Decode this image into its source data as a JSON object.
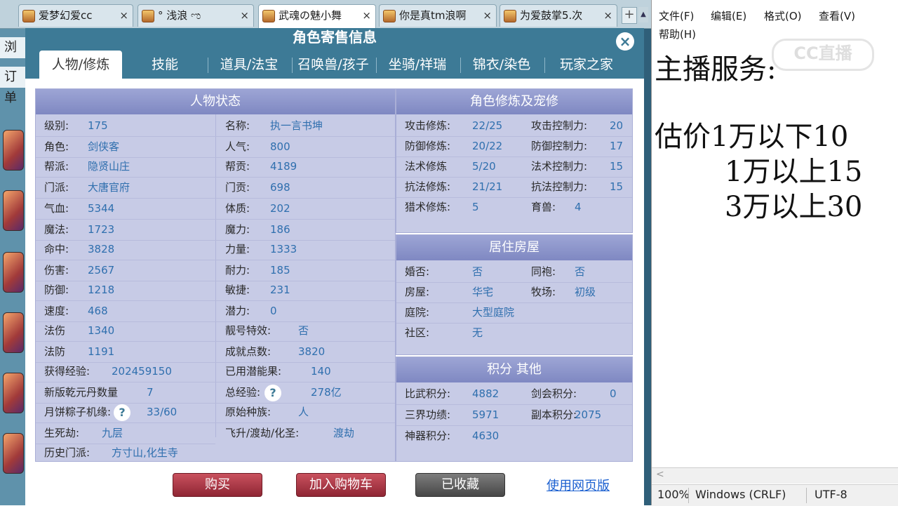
{
  "browser": {
    "tabs": [
      {
        "label": "爱梦幻爱cc",
        "close": "×",
        "active": false
      },
      {
        "label": "°  浅浪 ಌ",
        "close": "×",
        "active": false
      },
      {
        "label": "武魂の魅小舞",
        "close": "×",
        "active": true
      },
      {
        "label": "你是真tm浪啊",
        "close": "×",
        "active": false
      },
      {
        "label": "为爱鼓掌5.次",
        "close": "×",
        "active": false
      }
    ],
    "new_tab": "+",
    "left_labels": [
      "浏",
      "订单"
    ]
  },
  "dialog": {
    "title": "角色寄售信息",
    "close": "×",
    "tabs": [
      "人物/修炼",
      "技能",
      "道具/法宝",
      "召唤兽/孩子",
      "坐骑/祥瑞",
      "锦衣/染色",
      "玩家之家"
    ],
    "status": {
      "header": "人物状态",
      "left": [
        {
          "k": "级别:",
          "v": "175"
        },
        {
          "k": "角色:",
          "v": "剑侠客"
        },
        {
          "k": "帮派:",
          "v": "隐贤山庄"
        },
        {
          "k": "门派:",
          "v": "大唐官府"
        },
        {
          "k": "气血:",
          "v": "5344"
        },
        {
          "k": "魔法:",
          "v": "1723"
        },
        {
          "k": "命中:",
          "v": "3828"
        },
        {
          "k": "伤害:",
          "v": "2567"
        },
        {
          "k": "防御:",
          "v": "1218"
        },
        {
          "k": "速度:",
          "v": "468"
        },
        {
          "k": "法伤",
          "v": "1340"
        },
        {
          "k": "法防",
          "v": "1191"
        },
        {
          "k": "获得经验:",
          "v": "202459150"
        },
        {
          "k": "新版乾元丹数量",
          "v": "7"
        },
        {
          "k": "月饼粽子机缘:",
          "v": "33/60"
        },
        {
          "k": "生死劫:",
          "v": "九层"
        },
        {
          "k": "历史门派:",
          "v": "方寸山,化生寺"
        }
      ],
      "right": [
        {
          "k": "名称:",
          "v": "执一言书坤"
        },
        {
          "k": "人气:",
          "v": "800"
        },
        {
          "k": "帮贡:",
          "v": "4189"
        },
        {
          "k": "门贡:",
          "v": "698"
        },
        {
          "k": "体质:",
          "v": "202"
        },
        {
          "k": "魔力:",
          "v": "186"
        },
        {
          "k": "力量:",
          "v": "1333"
        },
        {
          "k": "耐力:",
          "v": "185"
        },
        {
          "k": "敏捷:",
          "v": "231"
        },
        {
          "k": "潜力:",
          "v": "0"
        },
        {
          "k": "靓号特效:",
          "v": "否"
        },
        {
          "k": "成就点数:",
          "v": "3820"
        },
        {
          "k": "已用潜能果:",
          "v": "140"
        },
        {
          "k": "总经验:",
          "v": "278亿"
        },
        {
          "k": "原始种族:",
          "v": "人"
        },
        {
          "k": "飞升/渡劫/化圣:",
          "v": "渡劫"
        }
      ],
      "help_icon": "?"
    },
    "cultivation": {
      "header": "角色修炼及宠修",
      "rows": [
        {
          "k1": "攻击修炼:",
          "v1": "22/25",
          "k2": "攻击控制力:",
          "v2": "20"
        },
        {
          "k1": "防御修炼:",
          "v1": "20/22",
          "k2": "防御控制力:",
          "v2": "17"
        },
        {
          "k1": "法术修炼",
          "v1": "5/20",
          "k2": "法术控制力:",
          "v2": "15"
        },
        {
          "k1": "抗法修炼:",
          "v1": "21/21",
          "k2": "抗法控制力:",
          "v2": "15"
        },
        {
          "k1": "猎术修炼:",
          "v1": "5",
          "k2": "育兽:",
          "v2": "4"
        }
      ]
    },
    "house": {
      "header": "居住房屋",
      "rows": [
        {
          "k1": "婚否:",
          "v1": "否",
          "k2": "同袍:",
          "v2": "否"
        },
        {
          "k1": "房屋:",
          "v1": "华宅",
          "k2": "牧场:",
          "v2": "初级"
        },
        {
          "k1": "庭院:",
          "v1": "大型庭院",
          "k2": "",
          "v2": ""
        },
        {
          "k1": "社区:",
          "v1": "无",
          "k2": "",
          "v2": ""
        }
      ]
    },
    "points": {
      "header": "积分 其他",
      "rows": [
        {
          "k1": "比武积分:",
          "v1": "4882",
          "k2": "剑会积分:",
          "v2": "0"
        },
        {
          "k1": "三界功绩:",
          "v1": "5971",
          "k2": "副本积分:",
          "v2": "2075"
        },
        {
          "k1": "神器积分:",
          "v1": "4630",
          "k2": "",
          "v2": ""
        }
      ]
    },
    "footer": {
      "buy": "购买",
      "add_cart": "加入购物车",
      "collected": "已收藏",
      "web_version": "使用网页版"
    }
  },
  "notepad": {
    "menu": [
      "文件(F)",
      "编辑(E)",
      "格式(O)",
      "查看(V)",
      "帮助(H)"
    ],
    "lines": [
      "主播服务:",
      "估价1万以下10",
      "1万以上15",
      "3万以上30"
    ],
    "status": {
      "zoom": "100%",
      "line_ending": "Windows (CRLF)",
      "encoding": "UTF-8"
    },
    "scroll_left": "<"
  },
  "watermark": "CC直播"
}
